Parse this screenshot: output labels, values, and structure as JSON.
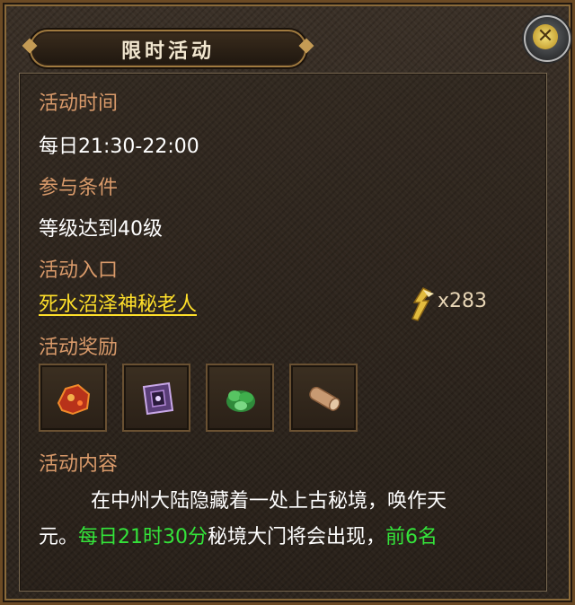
{
  "title": "限时活动",
  "close_icon": "close-icon",
  "sections": {
    "time_label": "活动时间",
    "time_value": "每日21:30-22:00",
    "condition_label": "参与条件",
    "condition_value": "等级达到40级",
    "entrance_label": "活动入口",
    "entrance_link": "死水沼泽神秘老人",
    "reward_label": "活动奖励",
    "content_label": "活动内容"
  },
  "currency": {
    "icon": "lightning-scroll-icon",
    "amount": "x283"
  },
  "rewards": [
    {
      "name": "red-ore-icon"
    },
    {
      "name": "purple-crystal-icon"
    },
    {
      "name": "green-herb-icon"
    },
    {
      "name": "wood-log-icon"
    }
  ],
  "description": {
    "line1": "在中州大陆隐藏着一处上古秘境，唤作天",
    "line2_part1": "元。",
    "line2_highlight1": "每日21时30分",
    "line2_part2": "秘境大门将会出现，",
    "line2_highlight2": "前6名"
  },
  "colors": {
    "label": "#d99a6a",
    "link": "#ffe02a",
    "highlight": "#34e33a",
    "frame_gold": "#a07a3f"
  }
}
